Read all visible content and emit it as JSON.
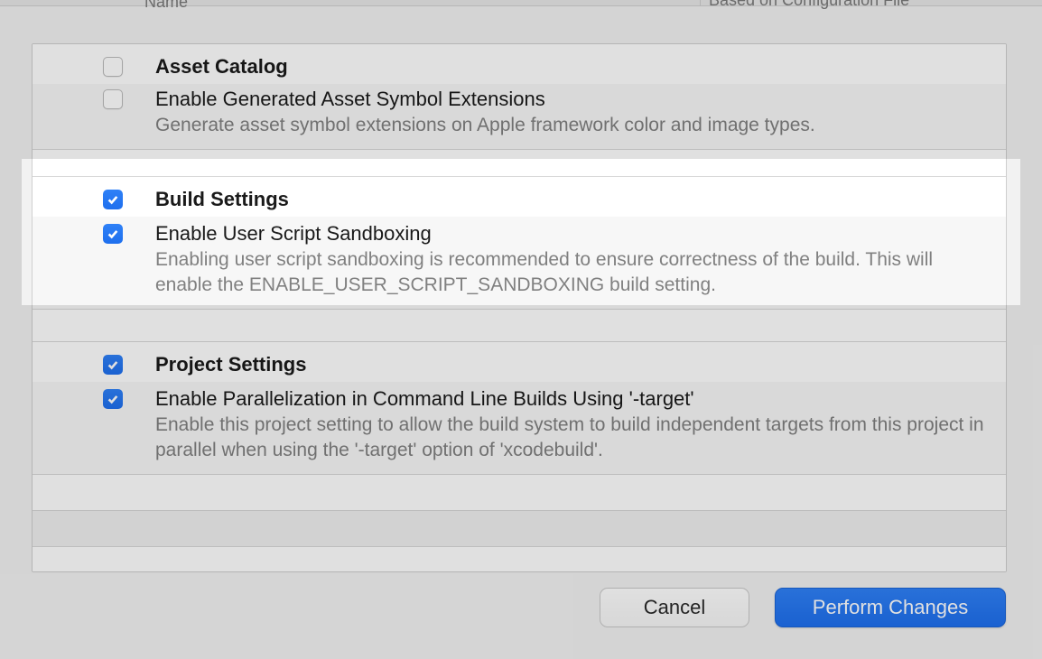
{
  "header": {
    "col1_label": "Name",
    "col2_label": "Based on Configuration File"
  },
  "sections": {
    "asset_catalog": {
      "title": "Asset Catalog",
      "checked": false,
      "item": {
        "title": "Enable Generated Asset Symbol Extensions",
        "desc": "Generate asset symbol extensions on Apple framework color and image types.",
        "checked": false
      }
    },
    "build_settings": {
      "title": "Build Settings",
      "checked": true,
      "item": {
        "title": "Enable User Script Sandboxing",
        "desc": "Enabling user script sandboxing is recommended to ensure correctness of the build. This will enable the ENABLE_USER_SCRIPT_SANDBOXING build setting.",
        "checked": true
      }
    },
    "project_settings": {
      "title": "Project Settings",
      "checked": true,
      "item": {
        "title": "Enable Parallelization in Command Line Builds Using '-target'",
        "desc": "Enable this project setting to allow the build system to build independent targets from this project in parallel when using the '-target' option of 'xcodebuild'.",
        "checked": true
      }
    }
  },
  "buttons": {
    "cancel": "Cancel",
    "perform": "Perform Changes"
  }
}
